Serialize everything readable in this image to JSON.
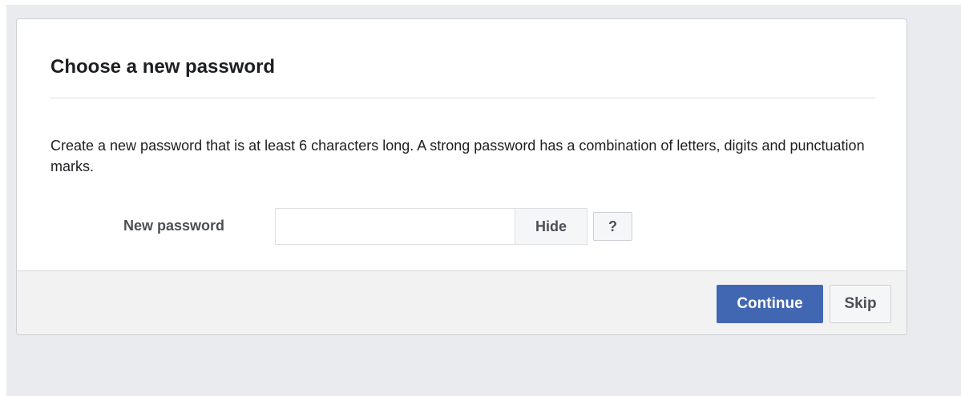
{
  "dialog": {
    "title": "Choose a new password",
    "description": "Create a new password that is at least 6 characters long. A strong password has a combination of letters, digits and punctuation marks.",
    "field_label": "New password",
    "password_value": "",
    "hide_label": "Hide",
    "help_label": "?"
  },
  "footer": {
    "continue_label": "Continue",
    "skip_label": "Skip"
  },
  "colors": {
    "page_background": "#e9ebee",
    "primary_button": "#4267b2",
    "footer_background": "#f2f2f2"
  }
}
